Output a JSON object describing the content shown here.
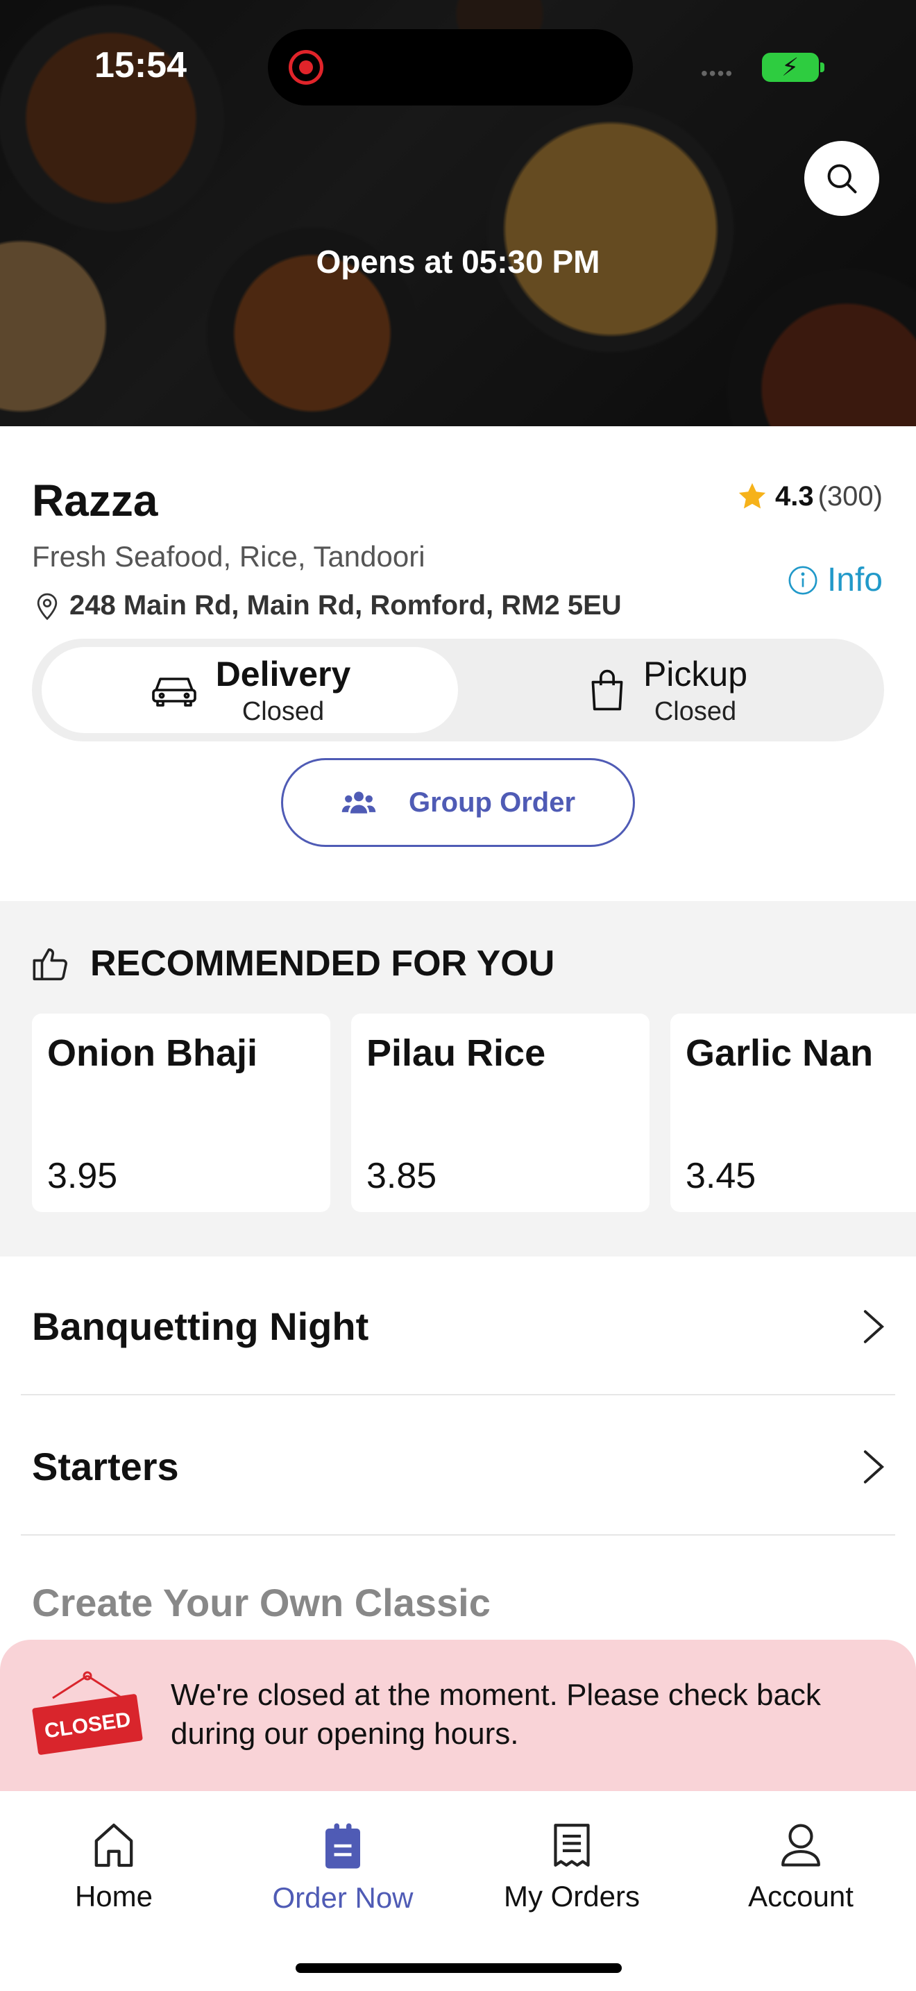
{
  "status_bar": {
    "time": "15:54",
    "signal": "••••"
  },
  "hero": {
    "opens_text": "Opens at 05:30 PM"
  },
  "restaurant": {
    "name": "Razza",
    "rating": "4.3",
    "rating_count": "(300)",
    "cuisine": "Fresh Seafood, Rice, Tandoori",
    "address": "248 Main Rd, Main Rd, Romford, RM2 5EU",
    "info_label": "Info"
  },
  "order_modes": [
    {
      "title": "Delivery",
      "status": "Closed",
      "selected": true
    },
    {
      "title": "Pickup",
      "status": "Closed",
      "selected": false
    }
  ],
  "group_order_label": "Group Order",
  "recommended": {
    "heading": "RECOMMENDED FOR YOU",
    "items": [
      {
        "name": "Onion Bhaji",
        "price": "3.95"
      },
      {
        "name": "Pilau Rice",
        "price": "3.85"
      },
      {
        "name": "Garlic Nan",
        "price": "3.45"
      }
    ]
  },
  "categories": [
    {
      "label": "Banquetting Night"
    },
    {
      "label": "Starters"
    },
    {
      "label": "Create Your Own Classic"
    }
  ],
  "closed_banner": {
    "sign_text": "CLOSED",
    "message": "We're closed at the moment. Please check back during our opening hours."
  },
  "bottom_nav": [
    {
      "label": "Home",
      "icon": "home-icon",
      "active": false
    },
    {
      "label": "Order Now",
      "icon": "order-icon",
      "active": true
    },
    {
      "label": "My Orders",
      "icon": "receipt-icon",
      "active": false
    },
    {
      "label": "Account",
      "icon": "account-icon",
      "active": false
    }
  ],
  "colors": {
    "accent": "#4f5bb5",
    "info": "#2199c9",
    "star": "#f6b21a",
    "closed_banner_bg": "#f9d3d7",
    "closed_sign": "#d9252c",
    "recording": "#e0242a",
    "battery": "#2ecc40"
  }
}
